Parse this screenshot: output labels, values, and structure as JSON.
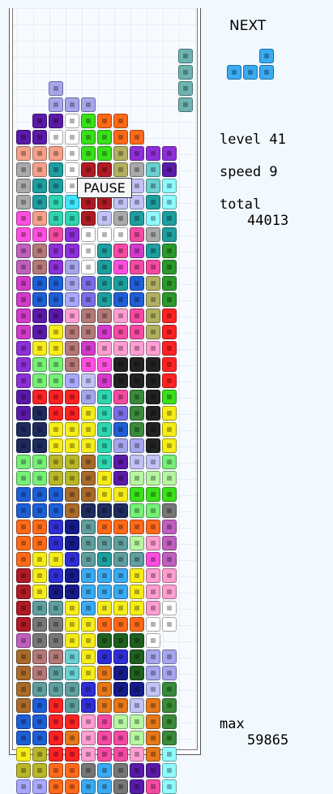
{
  "next": {
    "label": "NEXT",
    "piece_name": "L-tetromino",
    "color": "#3aaaf2"
  },
  "status": {
    "level_text": "level 41",
    "speed_text": "speed 9",
    "total_label": "total",
    "total_value": "44013",
    "max_label": "max",
    "max_value": "59865",
    "pause_label": "PAUSE"
  },
  "palette": {
    "A": "#3aaaf2",
    "B": "#1e5fd6",
    "C": "#2e2ed6",
    "D": "#151b8a",
    "E": "#1d2b5e",
    "F": "#7a6de6",
    "G": "#a6a6ee",
    "H": "#c2c2f6",
    "I": "#a8a8ff",
    "J": "#8e2fd9",
    "K": "#5a1aa8",
    "L": "#a9309a",
    "M": "#d23ac9",
    "N": "#ff4fe0",
    "O": "#f54aa3",
    "P": "#ff9ed1",
    "Q": "#c24f4f",
    "R": "#b01a24",
    "S": "#ff2222",
    "T": "#f5a08a",
    "U": "#ff6a1a",
    "V": "#e5781a",
    "W": "#a96a2a",
    "X": "#7a7a1a",
    "Y": "#b8b828",
    "Z": "#f6ec18",
    "a": "#2ed5b0",
    "b": "#1e9e9e",
    "c": "#6ad0d0",
    "d": "#5f9f9f",
    "e": "#3ee5ff",
    "f": "#8ffbff",
    "g": "#bff9ea",
    "h": "#3ae01a",
    "i": "#76f076",
    "j": "#b6f6a0",
    "k": "#2a9a2a",
    "l": "#1f5f1f",
    "m": "#3a8a3a",
    "n": "#8f9f2f",
    "o": "#b0b060",
    "p": "#aaaaaa",
    "q": "#777777",
    "r": "#222222",
    "s": "#ffffff",
    "t": "#b57878",
    "u": "#ff8a3a",
    "v": "#5a5aef",
    "w": "#bf60bf"
  },
  "well": {
    "falling_piece": "I-tetromino",
    "falling_color": "#6db3b0",
    "rows": [
      "..........",
      "..........",
      "..........",
      "..........",
      "..........",
      "..........",
      "..G.......",
      "..GGG.....",
      ".KKshUU...",
      "KKsshhUU..",
      "TTTshhoJJJ",
      "pTbsRRopcK",
      "pbbsRRGHcf",
      "pbaeRRHHbf",
      "NTaaRHpbfb",
      "NNOJsssOpb",
      "wtJJsbOMbk",
      "wtJGsbNOOk",
      "MBBGFbbBok",
      "MBBIFbBBok",
      "MKKPttPOoS",
      "MKZttMOOoS",
      "JZZtMPPPPS",
      "JiitNNrrrS",
      "JiiIHMrrrS",
      "KSSSGaOmrh",
      "KESSZaFmrZ",
      "EEZZZaBmrZ",
      "EEZZZaGGrZ",
      "iiYYWaKHHi",
      "iiYYWZKjjj",
      "BBBWWZZhhh",
      "BBBWEEEiiq",
      "UUCDdUUUUw",
      "UUCDdddjPw",
      "UZZCdbddNw",
      "RZCDAAAZPP",
      "RZDDAAAZPP",
      "RddZAZZZPs",
      "RqqZZUUUss",
      "wqqZZllls",
      "WttcZCClGG",
      "WtdcZVDlGG",
      "WdddCVDDHm",
      "WBSdCVVHVm",
      "BBSSPOjjVm",
      "BBSVPOOjVm",
      "ZYSSPOOPVf",
      "YYUUqAqKKf",
      "IIUUAAqKOf"
    ]
  }
}
